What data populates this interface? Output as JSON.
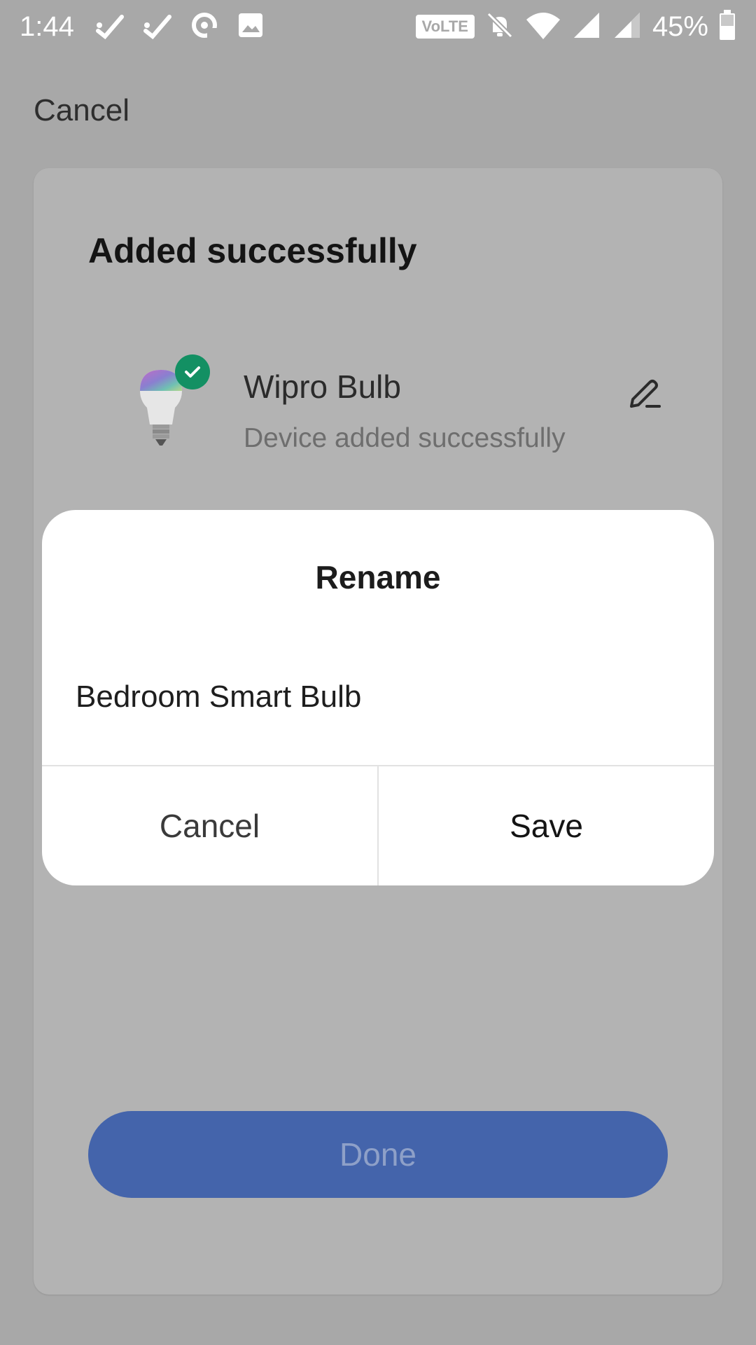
{
  "status_bar": {
    "time": "1:44",
    "volte_label": "VoLTE",
    "battery_percent": "45%",
    "icons": [
      "missed-call-icon",
      "missed-call-icon",
      "sync-icon",
      "image-icon",
      "volte-icon",
      "notifications-off-icon",
      "wifi-icon",
      "signal-icon",
      "signal-icon",
      "battery-icon"
    ]
  },
  "header": {
    "cancel_label": "Cancel"
  },
  "card": {
    "title": "Added successfully",
    "device": {
      "name": "Wipro Bulb",
      "status": "Device added successfully",
      "icon": "bulb-icon",
      "badge_icon": "check-icon",
      "edit_icon": "pencil-icon"
    },
    "done_label": "Done"
  },
  "dialog": {
    "title": "Rename",
    "input_value": "Bedroom Smart Bulb",
    "cancel_label": "Cancel",
    "save_label": "Save"
  },
  "colors": {
    "scrim_background": "#a8a8a8",
    "card_background": "#b3b3b3",
    "accent_done": "#4464ab",
    "success_badge": "#139063",
    "dialog_background": "#ffffff"
  }
}
